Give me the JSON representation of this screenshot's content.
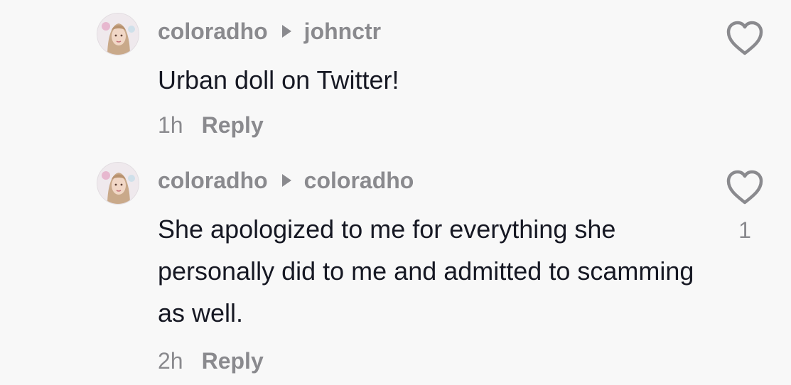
{
  "comments": [
    {
      "author": "coloradho",
      "reply_to": "johnctr",
      "text": "Urban doll on Twitter!",
      "time": "1h",
      "reply_label": "Reply",
      "likes": ""
    },
    {
      "author": "coloradho",
      "reply_to": "coloradho",
      "text": "She apologized to me for everything she personally did to me and admitted to scamming as well.",
      "time": "2h",
      "reply_label": "Reply",
      "likes": "1"
    }
  ],
  "icons": {
    "like": "heart-outline-icon",
    "reply_arrow": "play-triangle-icon"
  },
  "colors": {
    "background": "#f8f8f8",
    "text": "#161823",
    "secondary": "#8a8a8e"
  }
}
